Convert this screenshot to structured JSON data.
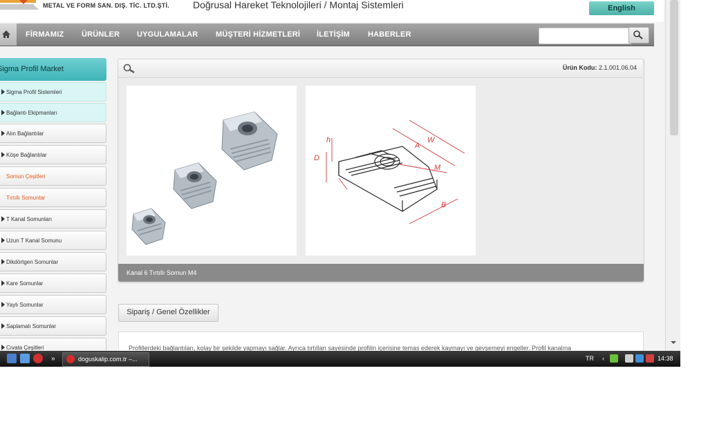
{
  "header": {
    "company": "METAL VE FORM SAN. DIŞ. TİC. LTD.ŞTİ.",
    "tagline": "Doğrusal Hareket Teknolojileri / Montaj Sistemleri",
    "language_button": "English"
  },
  "nav": {
    "items": [
      "FİRMAMIZ",
      "ÜRÜNLER",
      "UYGULAMALAR",
      "MÜŞTERİ HİZMETLERİ",
      "İLETİŞİM",
      "HABERLER"
    ],
    "search_placeholder": ""
  },
  "sidebar": {
    "title": "Sigma Profil Market",
    "items": [
      {
        "label": "Sigma Profil Sistemleri",
        "state": "highlight"
      },
      {
        "label": "Bağlantı Ekipmanları",
        "state": "highlight"
      },
      {
        "label": "Alın Bağlantılar",
        "state": "normal"
      },
      {
        "label": "Köşe Bağlantılar",
        "state": "normal"
      },
      {
        "label": "Somun Çeşitleri",
        "state": "active"
      },
      {
        "label": "Tırtıllı Somunlar",
        "state": "active"
      },
      {
        "label": "T Kanal Somunları",
        "state": "normal"
      },
      {
        "label": "Uzun T Kanal Somunu",
        "state": "normal"
      },
      {
        "label": "Dikdörtgen Somunlar",
        "state": "normal"
      },
      {
        "label": "Kare Somunlar",
        "state": "normal"
      },
      {
        "label": "Yaylı Somunlar",
        "state": "normal"
      },
      {
        "label": "Saplamalı Somunlar",
        "state": "normal"
      },
      {
        "label": "Cıvata Çeşitleri",
        "state": "normal"
      }
    ]
  },
  "product": {
    "code_label": "Ürün Kodu:",
    "code_value": "2.1.001.06.04",
    "caption": "Kanal 6 Tırtıllı Somun M4",
    "drawing_labels": [
      "h",
      "D",
      "A",
      "W",
      "M",
      "B"
    ]
  },
  "tabs": {
    "specs_button": "Sipariş / Genel Özellikler"
  },
  "description": {
    "text": "Profillerdeki bağlantıları, kolay bir şekilde yapmayı sağlar. Ayrıca tırtılları sayesinde profilin içerisine temas ederek kaymayı ve gevşemeyi engeller. Profil kanalına"
  },
  "taskbar": {
    "window_title": "doguskalip.com.tr –...",
    "language": "TR",
    "clock": "14:38"
  },
  "colors": {
    "accent": "#4fb3a9",
    "nav": "#8c8c8c",
    "active_link": "#e05a1a"
  }
}
